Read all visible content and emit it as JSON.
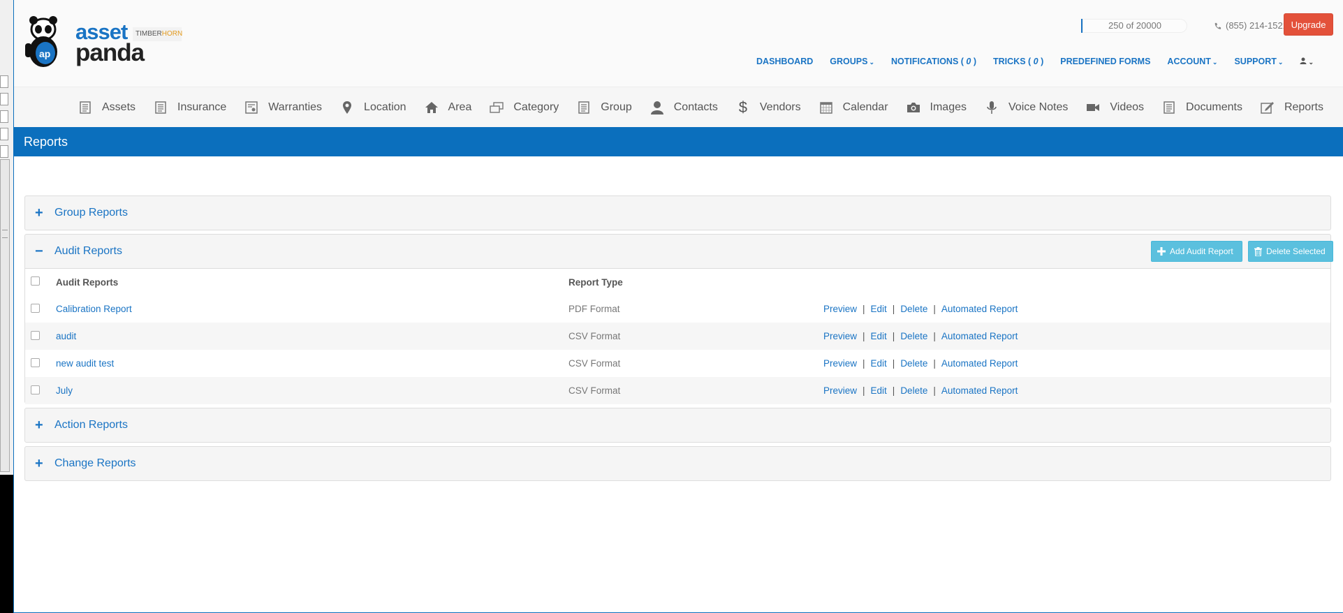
{
  "header": {
    "brand_line1": "asset",
    "brand_line2": "panda",
    "partner_logo_main": "TIMBER",
    "partner_logo_accent": "HORN",
    "usage": "250 of 20000",
    "phone": "(855) 214-1521",
    "upgrade_label": "Upgrade"
  },
  "top_nav": [
    {
      "label": "DASHBOARD"
    },
    {
      "label": "GROUPS",
      "dropdown": true
    },
    {
      "label": "NOTIFICATIONS ( ",
      "count": "0",
      "suffix": " )"
    },
    {
      "label": "TRICKS ( ",
      "count": "0",
      "suffix": " )"
    },
    {
      "label": "PREDEFINED FORMS"
    },
    {
      "label": "ACCOUNT",
      "dropdown": true
    },
    {
      "label": "SUPPORT",
      "dropdown": true
    }
  ],
  "modules": [
    {
      "label": "Assets",
      "icon": "document-icon"
    },
    {
      "label": "Insurance",
      "icon": "document-icon"
    },
    {
      "label": "Warranties",
      "icon": "certificate-icon"
    },
    {
      "label": "Location",
      "icon": "map-marker-icon"
    },
    {
      "label": "Area",
      "icon": "home-icon"
    },
    {
      "label": "Category",
      "icon": "category-icon"
    },
    {
      "label": "Group",
      "icon": "document-icon"
    },
    {
      "label": "Contacts",
      "icon": "user-icon"
    },
    {
      "label": "Vendors",
      "icon": "dollar-icon"
    },
    {
      "label": "Calendar",
      "icon": "calendar-icon"
    },
    {
      "label": "Images",
      "icon": "camera-icon"
    },
    {
      "label": "Voice Notes",
      "icon": "microphone-icon"
    },
    {
      "label": "Videos",
      "icon": "video-camera-icon"
    },
    {
      "label": "Documents",
      "icon": "document-icon"
    },
    {
      "label": "Reports",
      "icon": "edit-icon"
    }
  ],
  "page_title": "Reports",
  "panels": {
    "group": {
      "title": "Group Reports",
      "toggle": "+"
    },
    "audit": {
      "title": "Audit Reports",
      "toggle": "−",
      "add_label": "Add Audit Report",
      "delete_label": "Delete Selected"
    },
    "action": {
      "title": "Action Reports",
      "toggle": "+"
    },
    "change": {
      "title": "Change Reports",
      "toggle": "+"
    }
  },
  "audit_table": {
    "columns": [
      "Audit Reports",
      "Report Type"
    ],
    "actions": [
      "Preview",
      "Edit",
      "Delete",
      "Automated Report"
    ],
    "rows": [
      {
        "name": "Calibration Report",
        "type": "PDF Format"
      },
      {
        "name": "audit",
        "type": "CSV Format"
      },
      {
        "name": "new audit test",
        "type": "CSV Format"
      },
      {
        "name": "July",
        "type": "CSV Format"
      }
    ]
  }
}
